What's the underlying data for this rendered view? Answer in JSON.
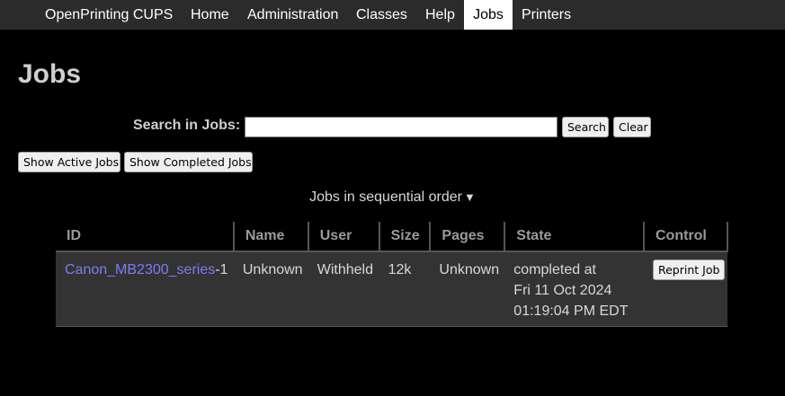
{
  "nav": {
    "brand": "OpenPrinting CUPS",
    "items": [
      {
        "label": "Home"
      },
      {
        "label": "Administration"
      },
      {
        "label": "Classes"
      },
      {
        "label": "Help"
      },
      {
        "label": "Jobs"
      },
      {
        "label": "Printers"
      }
    ],
    "active": "Jobs"
  },
  "page": {
    "title": "Jobs"
  },
  "search": {
    "label": "Search in Jobs:",
    "value": "",
    "search_button": "Search",
    "clear_button": "Clear"
  },
  "filters": {
    "active_button": "Show Active Jobs",
    "completed_button": "Show Completed Jobs"
  },
  "order": {
    "text": "Jobs in sequential order",
    "caret": "▼"
  },
  "table": {
    "headers": [
      "ID",
      "Name",
      "User",
      "Size",
      "Pages",
      "State",
      "Control"
    ],
    "rows": [
      {
        "id_link": "Canon_MB2300_series",
        "id_suffix": "-1",
        "name": "Unknown",
        "user": "Withheld",
        "size": "12k",
        "pages": "Unknown",
        "state_lines": [
          "completed at",
          "Fri 11 Oct 2024",
          "01:19:04 PM EDT"
        ],
        "control_button": "Reprint Job"
      }
    ]
  },
  "colors": {
    "background": "#000000",
    "navbar": "#2b2b2b",
    "link": "#7b7bff",
    "row_background": "#333333"
  }
}
